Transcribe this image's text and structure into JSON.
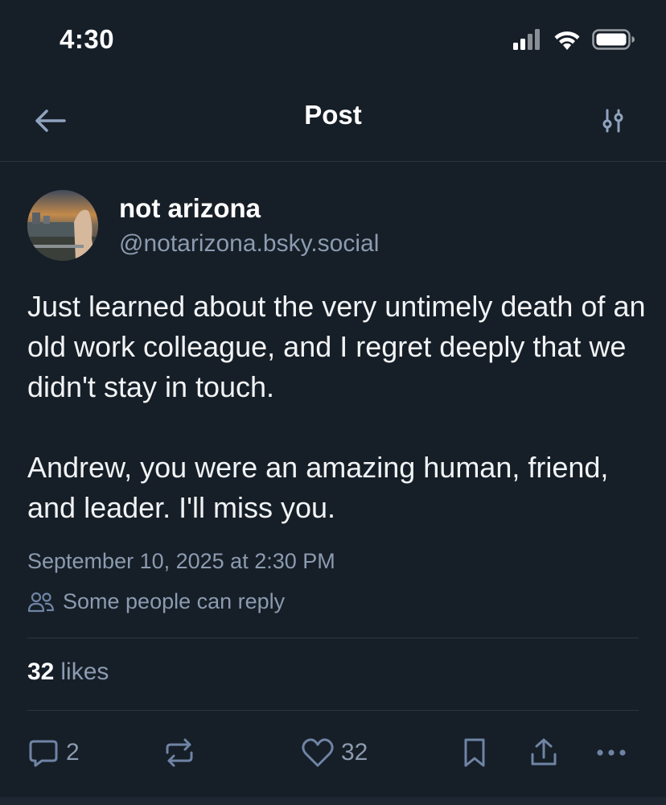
{
  "status_bar": {
    "time": "4:30"
  },
  "header": {
    "title": "Post"
  },
  "post": {
    "author_name": "not arizona",
    "author_handle": "@notarizona.bsky.social",
    "text": "Just learned about the very untimely death of an old work colleague, and I regret deeply that we didn't stay in touch.\n\nAndrew, you were an amazing human, friend, and leader. I'll miss you.",
    "timestamp": "September 10, 2025 at 2:30 PM",
    "reply_setting": "Some people can reply",
    "likes_count": "32",
    "likes_label": "likes"
  },
  "actions": {
    "reply_count": "2",
    "like_count": "32"
  },
  "colors": {
    "background": "#161e27",
    "muted_text": "#8c9bb0",
    "divider": "#2b3644"
  }
}
